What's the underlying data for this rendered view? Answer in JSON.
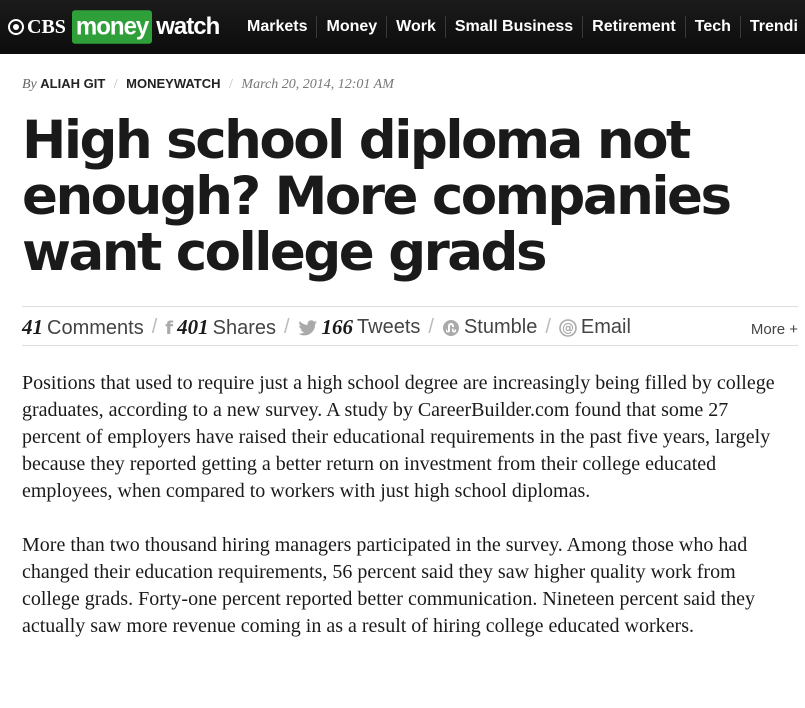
{
  "header": {
    "logo": {
      "cbs": "CBS",
      "money": "money",
      "watch": "watch"
    },
    "nav": [
      "Markets",
      "Money",
      "Work",
      "Small Business",
      "Retirement",
      "Tech",
      "Trendi"
    ]
  },
  "byline": {
    "by": "By",
    "author": "ALIAH GIT",
    "source": "MONEYWATCH",
    "date": "March 20, 2014, 12:01 AM"
  },
  "headline": "High school diploma not enough? More companies want college grads",
  "share": {
    "comments_count": "41",
    "comments_label": "Comments",
    "shares_count": "401",
    "shares_label": "Shares",
    "tweets_count": "166",
    "tweets_label": "Tweets",
    "stumble_label": "Stumble",
    "email_label": "Email",
    "more_label": "More +"
  },
  "article": {
    "paragraphs": [
      "Positions that used to require just a high school degree are increasingly being filled by college graduates, according to a new survey. A study by CareerBuilder.com found that some 27 percent of employers have raised their educational requirements in the past five years, largely because they reported getting a better return on investment from their college educated employees, when compared to workers with just high school diplomas.",
      "More than two thousand hiring managers participated in the survey. Among those who had changed their education requirements, 56 percent said they saw higher quality work from college grads. Forty-one percent reported better communication. Nineteen percent said they actually saw more revenue coming in as a result of hiring college educated workers."
    ]
  },
  "colors": {
    "topbar": "#111111",
    "money_green": "#2f9f3a",
    "text": "#1a1a1a"
  }
}
